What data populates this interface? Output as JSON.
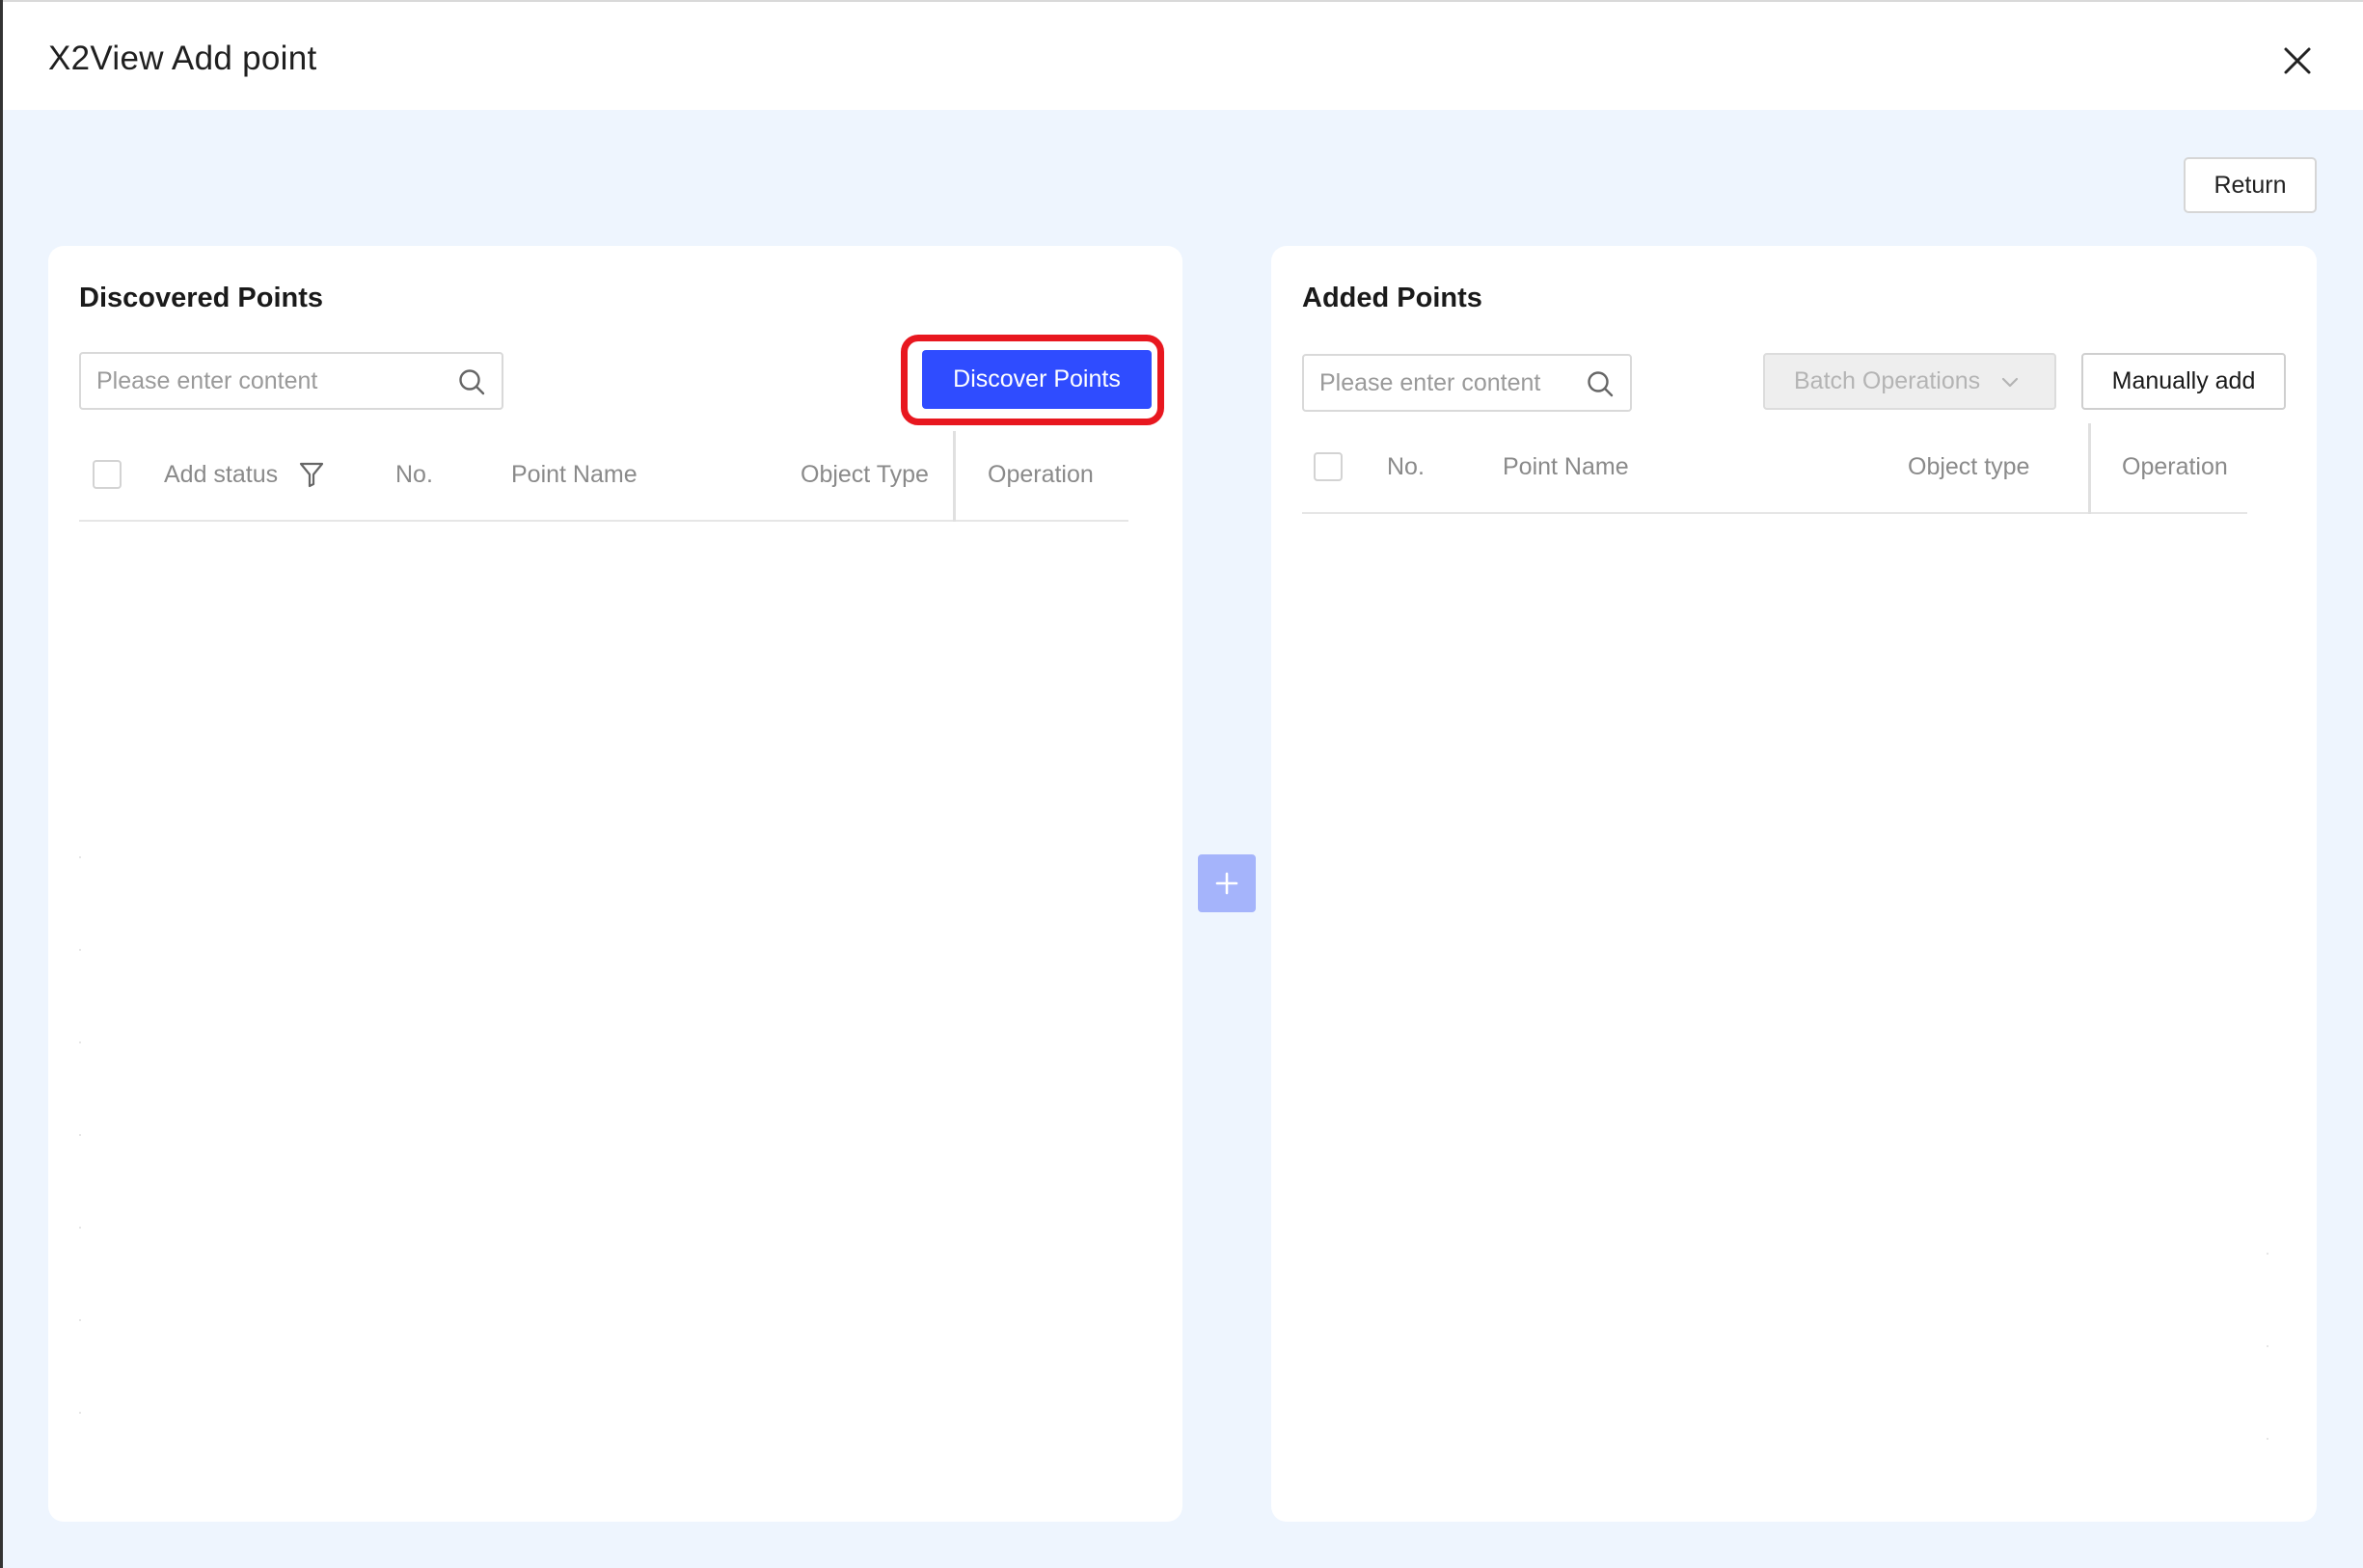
{
  "window": {
    "title": "X2View Add point"
  },
  "toolbar": {
    "return_label": "Return"
  },
  "discovered": {
    "title": "Discovered Points",
    "search_placeholder": "Please enter content",
    "discover_button": "Discover Points",
    "columns": [
      "Add status",
      "No.",
      "Point Name",
      "Object Type",
      "Operation"
    ],
    "rows": []
  },
  "added": {
    "title": "Added Points",
    "search_placeholder": "Please enter content",
    "batch_label": "Batch Operations",
    "manual_add_label": "Manually add",
    "columns": [
      "No.",
      "Point Name",
      "Object type",
      "Operation"
    ],
    "rows": []
  },
  "colors": {
    "primary": "#2f4cff",
    "highlight_outline": "#e8171f",
    "transfer_button": "#a5b4fb",
    "page_background": "#eef5fe"
  },
  "icons": {
    "close": "close-icon",
    "search": "search-icon",
    "filter": "filter-icon",
    "chevron": "chevron-down-icon",
    "transfer": "plus-icon"
  }
}
